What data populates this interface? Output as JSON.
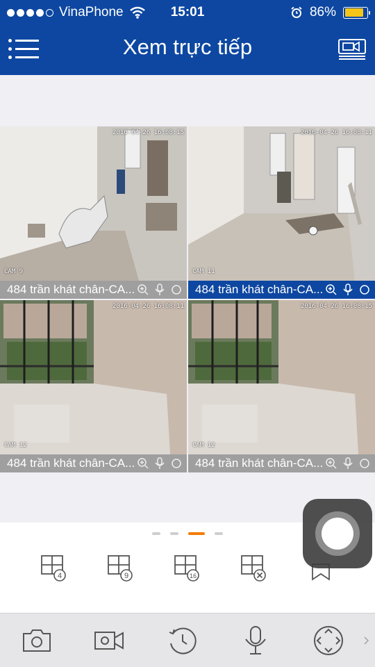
{
  "status_bar": {
    "carrier": "VinaPhone",
    "time": "15:01",
    "battery": "86%",
    "signal_bars_filled": 4,
    "signal_bars_total": 5
  },
  "header": {
    "title": "Xem trực tiếp"
  },
  "cameras": [
    {
      "name": "484 trần khát chân-CA...",
      "timestamp": "2016-04-26 16:08:15",
      "cam_label": "CAM 9",
      "active": false
    },
    {
      "name": "484 trần khát chân-CA...",
      "timestamp": "2016-04-26 16:08:11",
      "cam_label": "CAM 11",
      "active": true
    },
    {
      "name": "484 trần khát chân-CA...",
      "timestamp": "2016-04-26 16:08:11",
      "cam_label": "CAM 12",
      "active": false
    },
    {
      "name": "484 trần khát chân-CA...",
      "timestamp": "2016-04-26 16:08:15",
      "cam_label": "CAM 12",
      "active": false
    }
  ],
  "pager": {
    "pages": 4,
    "current": 3
  },
  "layouts": [
    {
      "label": "4",
      "icon": "grid-4-icon"
    },
    {
      "label": "9",
      "icon": "grid-9-icon"
    },
    {
      "label": "16",
      "icon": "grid-16-icon"
    },
    {
      "label": "",
      "icon": "close-layout-icon"
    },
    {
      "label": "",
      "icon": "favorite-icon"
    }
  ],
  "toolbar": [
    {
      "icon": "snapshot-icon"
    },
    {
      "icon": "record-icon"
    },
    {
      "icon": "playback-icon"
    },
    {
      "icon": "microphone-icon"
    },
    {
      "icon": "ptz-icon"
    }
  ],
  "colors": {
    "header": "#0d47a1",
    "accent": "#f57c00",
    "battery": "#f5c518"
  }
}
